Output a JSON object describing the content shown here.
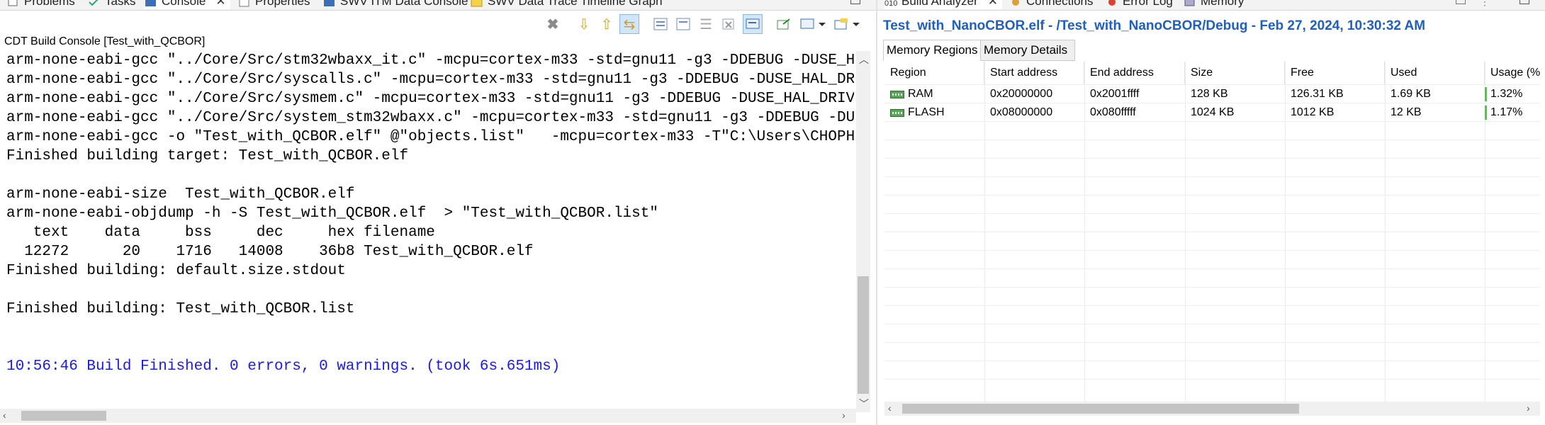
{
  "left_tabs": [
    {
      "label": "Problems",
      "icon": "problems-icon"
    },
    {
      "label": "Tasks",
      "icon": "tasks-icon"
    },
    {
      "label": "Console",
      "icon": "console-icon",
      "active": true
    },
    {
      "label": "Properties",
      "icon": "properties-icon"
    },
    {
      "label": "SWV ITM Data Console",
      "icon": "swv-console-icon"
    },
    {
      "label": "SWV Data Trace Timeline Graph",
      "icon": "timeline-graph-icon"
    }
  ],
  "right_tabs": [
    {
      "label": "Build Analyzer",
      "icon": "build-analyzer-icon",
      "active": true
    },
    {
      "label": "Connections",
      "icon": "connections-icon"
    },
    {
      "label": "Error Log",
      "icon": "error-log-icon"
    },
    {
      "label": "Memory",
      "icon": "memory-icon"
    }
  ],
  "console": {
    "label": "CDT Build Console [Test_with_QCBOR]",
    "lines": [
      "arm-none-eabi-gcc \"../Core/Src/stm32wbaxx_it.c\" -mcpu=cortex-m33 -std=gnu11 -g3 -DDEBUG -DUSE_H",
      "arm-none-eabi-gcc \"../Core/Src/syscalls.c\" -mcpu=cortex-m33 -std=gnu11 -g3 -DDEBUG -DUSE_HAL_DR",
      "arm-none-eabi-gcc \"../Core/Src/sysmem.c\" -mcpu=cortex-m33 -std=gnu11 -g3 -DDEBUG -DUSE_HAL_DRIV",
      "arm-none-eabi-gcc \"../Core/Src/system_stm32wbaxx.c\" -mcpu=cortex-m33 -std=gnu11 -g3 -DDEBUG -DU",
      "arm-none-eabi-gcc -o \"Test_with_QCBOR.elf\" @\"objects.list\"   -mcpu=cortex-m33 -T\"C:\\Users\\CHOPH",
      "Finished building target: Test_with_QCBOR.elf",
      "",
      "arm-none-eabi-size  Test_with_QCBOR.elf",
      "arm-none-eabi-objdump -h -S Test_with_QCBOR.elf  > \"Test_with_QCBOR.list\"",
      "   text    data     bss     dec     hex filename",
      "  12272      20    1716   14008    36b8 Test_with_QCBOR.elf",
      "Finished building: default.size.stdout",
      "",
      "Finished building: Test_with_QCBOR.list",
      "",
      "",
      "10:56:46 Build Finished. 0 errors, 0 warnings. (took 6s.651ms)"
    ]
  },
  "build_analyzer": {
    "title": "Test_with_NanoCBOR.elf - /Test_with_NanoCBOR/Debug - Feb 27, 2024, 10:30:32 AM",
    "subtabs": [
      "Memory Regions",
      "Memory Details"
    ],
    "columns": [
      "Region",
      "Start address",
      "End address",
      "Size",
      "Free",
      "Used",
      "Usage (%"
    ],
    "rows": [
      {
        "region": "RAM",
        "start": "0x20000000",
        "end": "0x2001ffff",
        "size": "128 KB",
        "free": "126.31 KB",
        "used": "1.69 KB",
        "usage": "1.32%"
      },
      {
        "region": "FLASH",
        "start": "0x08000000",
        "end": "0x080fffff",
        "size": "1024 KB",
        "free": "1012 KB",
        "used": "12 KB",
        "usage": "1.17%"
      }
    ]
  },
  "colors": {
    "title_blue": "#1f5fbf",
    "finished_blue": "#1a1af0",
    "usage_green": "#3fcf3f"
  }
}
